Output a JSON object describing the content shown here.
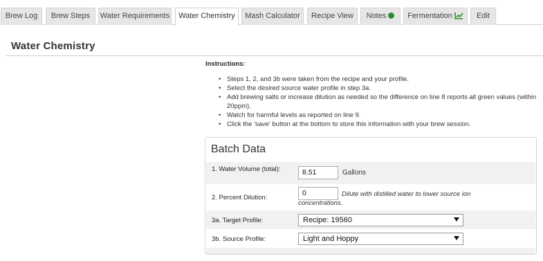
{
  "tabs": [
    {
      "label": "Brew Log"
    },
    {
      "label": "Brew Steps"
    },
    {
      "label": "Water Requirements"
    },
    {
      "label": "Water Chemistry",
      "active": true
    },
    {
      "label": "Mash Calculator"
    },
    {
      "label": "Recipe View"
    },
    {
      "label": "Notes",
      "icon": "status-dot-icon"
    },
    {
      "label": "Fermentation",
      "icon": "line-chart-icon"
    },
    {
      "label": "Edit"
    }
  ],
  "colors": {
    "notes_dot": "#2e8b2e",
    "chart_icon": "#2e8b2e"
  },
  "page": {
    "title": "Water Chemistry"
  },
  "instructions": {
    "title": "Instructions:",
    "items": [
      "Steps 1, 2, and 3b were taken from the recipe and your profile.",
      "Select the desired source water profile in step 3a.",
      "Add brewing salts or increase dilution as needed so the difference on line 8 reports all green values (within 20ppm).",
      "Watch for harmful levels as reported on line 9.",
      "Click the 'save' button at the bottom to store this information with your brew session."
    ]
  },
  "batch": {
    "title": "Batch Data",
    "water_volume": {
      "label": "1. Water Volume (total):",
      "value": "8.51",
      "unit": "Gallons"
    },
    "dilution": {
      "label": "2. Percent Dilution:",
      "value": "0",
      "hint": "Dilute with distilled water to lower source ion concentrations."
    },
    "target": {
      "label": "3a. Target Profile:",
      "value": "Recipe: 19560"
    },
    "source": {
      "label": "3b. Source Profile:",
      "value": "Light and Hoppy"
    }
  }
}
